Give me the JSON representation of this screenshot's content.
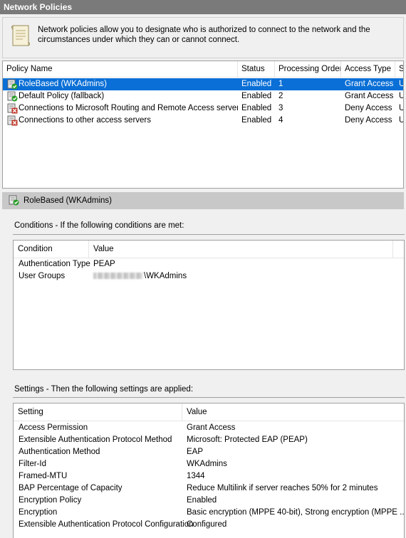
{
  "window": {
    "title": "Network Policies"
  },
  "info": {
    "message": "Network policies allow you to designate who is authorized to connect to the network and the circumstances under which they can or cannot connect."
  },
  "policy_list": {
    "columns": {
      "name": "Policy Name",
      "status": "Status",
      "order": "Processing Order",
      "access": "Access Type",
      "source": "S"
    },
    "rows": [
      {
        "name": "RoleBased (WKAdmins)",
        "status": "Enabled",
        "order": "1",
        "access": "Grant Access",
        "source": "U",
        "icon": "grant-policy-icon",
        "selected": true
      },
      {
        "name": "Default Policy (fallback)",
        "status": "Enabled",
        "order": "2",
        "access": "Grant Access",
        "source": "U",
        "icon": "grant-policy-icon",
        "selected": false
      },
      {
        "name": "Connections to Microsoft Routing and Remote Access server",
        "status": "Enabled",
        "order": "3",
        "access": "Deny Access",
        "source": "U",
        "icon": "deny-policy-icon",
        "selected": false
      },
      {
        "name": "Connections to other access servers",
        "status": "Enabled",
        "order": "4",
        "access": "Deny Access",
        "source": "U",
        "icon": "deny-policy-icon",
        "selected": false
      }
    ]
  },
  "detail": {
    "title": "RoleBased (WKAdmins)",
    "conditions": {
      "label": "Conditions - If the following conditions are met:",
      "columns": {
        "condition": "Condition",
        "value": "Value"
      },
      "rows": [
        {
          "condition": "Authentication Type",
          "value": "PEAP",
          "redacted_prefix": false
        },
        {
          "condition": "User Groups",
          "value": "\\WKAdmins",
          "redacted_prefix": true
        }
      ]
    },
    "settings": {
      "label": "Settings - Then the following settings are applied:",
      "columns": {
        "setting": "Setting",
        "value": "Value"
      },
      "rows": [
        {
          "setting": "Access Permission",
          "value": "Grant Access"
        },
        {
          "setting": "Extensible Authentication Protocol Method",
          "value": "Microsoft: Protected EAP (PEAP)"
        },
        {
          "setting": "Authentication Method",
          "value": "EAP"
        },
        {
          "setting": "Filter-Id",
          "value": "WKAdmins"
        },
        {
          "setting": "Framed-MTU",
          "value": "1344"
        },
        {
          "setting": "BAP Percentage of Capacity",
          "value": "Reduce Multilink if server reaches 50% for 2 minutes"
        },
        {
          "setting": "Encryption Policy",
          "value": "Enabled"
        },
        {
          "setting": "Encryption",
          "value": "Basic encryption (MPPE 40-bit), Strong encryption (MPPE ..."
        },
        {
          "setting": "Extensible Authentication Protocol Configuration",
          "value": "Configured"
        }
      ]
    }
  },
  "colors": {
    "selection": "#0a6fd6",
    "grant": "#2a9d2a",
    "deny": "#c0392b"
  }
}
